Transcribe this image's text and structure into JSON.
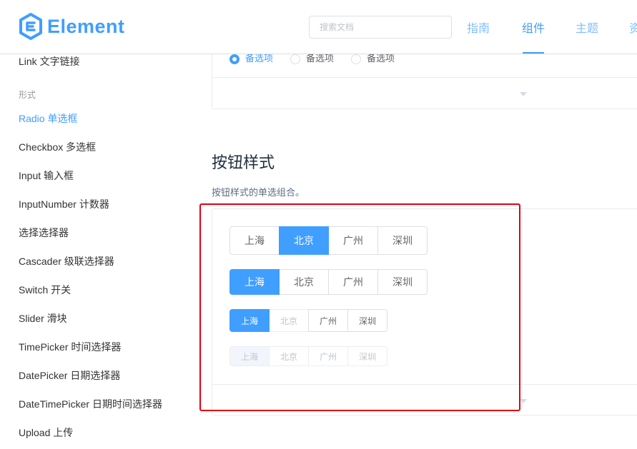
{
  "header": {
    "logo_text": "Element",
    "search_placeholder": "搜索文档",
    "nav": [
      "指南",
      "组件",
      "主题",
      "资"
    ]
  },
  "sidebar": {
    "items_top": [
      "Link 文字链接"
    ],
    "group_label": "形式",
    "items": [
      "Radio 单选框",
      "Checkbox 多选框",
      "Input 输入框",
      "InputNumber 计数器",
      "选择选择器",
      "Cascader 级联选择器",
      "Switch 开关",
      "Slider 滑块",
      "TimePicker 时间选择器",
      "DatePicker 日期选择器",
      "DateTimePicker 日期时间选择器",
      "Upload 上传"
    ],
    "active_index": 0
  },
  "main": {
    "prev_demo": {
      "radios": [
        "备选项",
        "备选项",
        "备选项"
      ]
    },
    "section_title": "按钮样式",
    "section_desc": "按钮样式的单选组合。",
    "groups": [
      {
        "size": "default",
        "options": [
          "上海",
          "北京",
          "广州",
          "深圳"
        ],
        "selected": 1,
        "disabled": false
      },
      {
        "size": "medium",
        "options": [
          "上海",
          "北京",
          "广州",
          "深圳"
        ],
        "selected": 0,
        "disabled": false
      },
      {
        "size": "small",
        "options": [
          "上海",
          "北京",
          "广州",
          "深圳"
        ],
        "selected": 0,
        "disabled_options": [
          1
        ]
      },
      {
        "size": "mini",
        "options": [
          "上海",
          "北京",
          "广州",
          "深圳"
        ],
        "selected": 0,
        "disabled": true
      }
    ]
  },
  "colors": {
    "primary": "#409eff",
    "highlight": "#e60012"
  }
}
